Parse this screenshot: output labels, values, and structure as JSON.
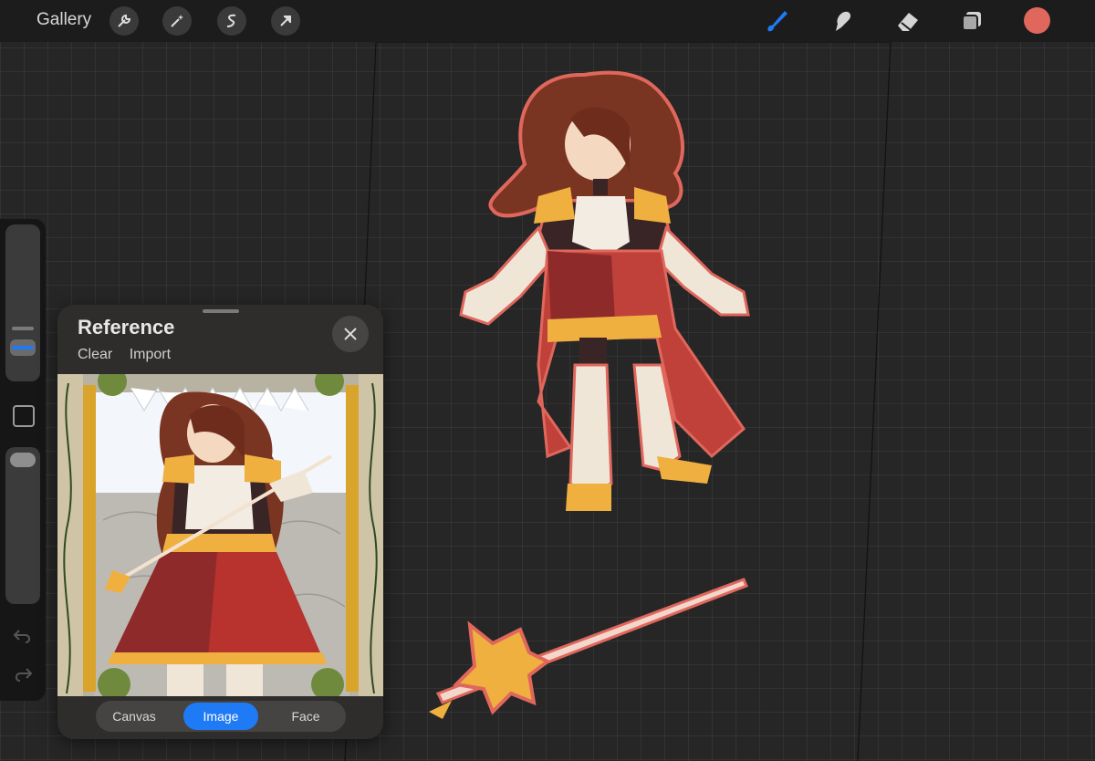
{
  "topbar": {
    "gallery_label": "Gallery",
    "left_tools": [
      "wrench-icon",
      "magic-wand-icon",
      "selection-icon",
      "transform-arrow-icon"
    ],
    "right_tools": [
      "brush-icon",
      "smudge-icon",
      "eraser-icon",
      "layers-icon"
    ],
    "current_color": "#e0675c",
    "active_tool": "brush"
  },
  "sidebar": {
    "tools": [
      "brush-size-slider",
      "modify-button",
      "opacity-slider",
      "undo-icon",
      "redo-icon"
    ]
  },
  "reference_panel": {
    "title": "Reference",
    "clear_label": "Clear",
    "import_label": "Import",
    "tabs": [
      {
        "label": "Canvas",
        "active": false
      },
      {
        "label": "Image",
        "active": true
      },
      {
        "label": "Face",
        "active": false
      }
    ]
  },
  "colors": {
    "accent": "#1f7bf5",
    "canvas_bg": "#262626",
    "toolbar_bg": "#1c1c1c",
    "character_hair": "#7a3522",
    "character_armor": "#f0b040",
    "character_skirt": "#c0413a"
  }
}
